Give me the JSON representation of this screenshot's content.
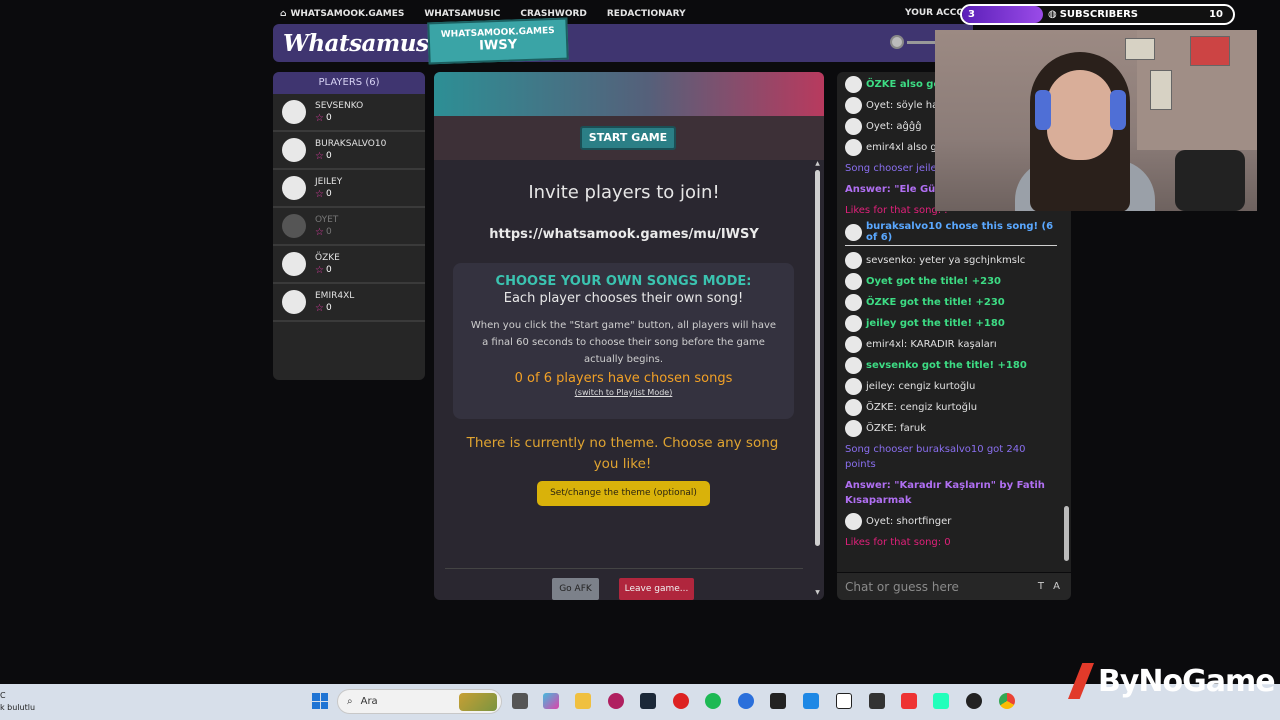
{
  "top_nav": {
    "items": [
      "WHATSAMOOK.GAMES",
      "WHATSAMUSIC",
      "CRASHWORD",
      "REDACTIONARY"
    ],
    "account": "YOUR ACCOUNT"
  },
  "subscriber_goal": {
    "current": "3",
    "label": "SUBSCRIBERS",
    "goal": "10",
    "progress": 0.3,
    "fill_color": "#9a4be8"
  },
  "header": {
    "logo": "Whatsamusic",
    "room_site": "WHATSAMOOK.GAMES",
    "room_code": "IWSY"
  },
  "players": {
    "title": "PLAYERS (6)",
    "list": [
      {
        "name": "SEVSENKO",
        "score": "0"
      },
      {
        "name": "BURAKSALVO10",
        "score": "0"
      },
      {
        "name": "JEILEY",
        "score": "0"
      },
      {
        "name": "OYET",
        "score": "0"
      },
      {
        "name": "ÖZKE",
        "score": "0"
      },
      {
        "name": "EMIR4XL",
        "score": "0"
      }
    ]
  },
  "main": {
    "start_button": "START GAME",
    "invite_heading": "Invite players to join!",
    "invite_link": "https://whatsamook.games/mu/IWSY",
    "mode_title": "CHOOSE YOUR OWN SONGS MODE:",
    "mode_subtitle": "Each player chooses their own song!",
    "mode_description": "When you click the \"Start game\" button, all players will have a final 60 seconds to choose their song before the game actually begins.",
    "chosen_status": "0 of 6 players have chosen songs",
    "switch_mode_link": "(switch to Playlist Mode)",
    "theme_text": "There is currently no theme. Choose any song you like!",
    "theme_button": "Set/change the theme (optional)",
    "afk_button": "Go AFK",
    "leave_button": "Leave game..."
  },
  "chat": {
    "messages": [
      {
        "type": "avatar",
        "style": "green",
        "text": "ÖZKE also got"
      },
      {
        "type": "avatar",
        "style": "normal",
        "text": "Oyet: söyle hac"
      },
      {
        "type": "avatar",
        "style": "normal",
        "text": "Oyet: aĝĝĝ"
      },
      {
        "type": "avatar",
        "style": "normal",
        "text": "emir4xl also g"
      },
      {
        "type": "sys",
        "style": "violet",
        "text": "Song chooser jeile"
      },
      {
        "type": "sys",
        "style": "purpleb",
        "text": "Answer: \"Ele Gün"
      },
      {
        "type": "sys",
        "style": "pink",
        "text": "Likes for that song: ."
      },
      {
        "type": "avatar",
        "style": "blue",
        "text": "buraksalvo10 chose this song! (6 of 6)"
      },
      {
        "type": "sep"
      },
      {
        "type": "avatar",
        "style": "normal",
        "text": "sevsenko: yeter ya sgchjnkmslc"
      },
      {
        "type": "avatar",
        "style": "green",
        "text": "Oyet got the title! +230"
      },
      {
        "type": "avatar",
        "style": "green",
        "text": "ÖZKE got the title! +230"
      },
      {
        "type": "avatar",
        "style": "green",
        "text": "jeiley got the title! +180"
      },
      {
        "type": "avatar",
        "style": "normal",
        "text": "emir4xl: KARADIR kaşaları"
      },
      {
        "type": "avatar",
        "style": "green",
        "text": "sevsenko got the title! +180"
      },
      {
        "type": "avatar",
        "style": "normal",
        "text": "jeiley: cengiz kurtoğlu"
      },
      {
        "type": "avatar",
        "style": "normal",
        "text": "ÖZKE: cengiz kurtoğlu"
      },
      {
        "type": "avatar",
        "style": "normal",
        "text": "ÖZKE: faruk"
      },
      {
        "type": "sys",
        "style": "violet",
        "text": "Song chooser buraksalvo10 got 240 points"
      },
      {
        "type": "sys",
        "style": "purpleb",
        "text": "Answer: \"Karadır Kaşların\" by Fatih Kısaparmak"
      },
      {
        "type": "avatar",
        "style": "normal",
        "text": "Oyet: shortfinger"
      },
      {
        "type": "sys",
        "style": "pink",
        "text": "Likes for that song: 0"
      }
    ],
    "input_placeholder": "Chat or guess here",
    "input_suffix": "T A"
  },
  "taskbar": {
    "weather_line1": "C",
    "weather_line2": "k bulutlu",
    "search_placeholder": "Ara"
  },
  "watermark": "ByNoGame"
}
